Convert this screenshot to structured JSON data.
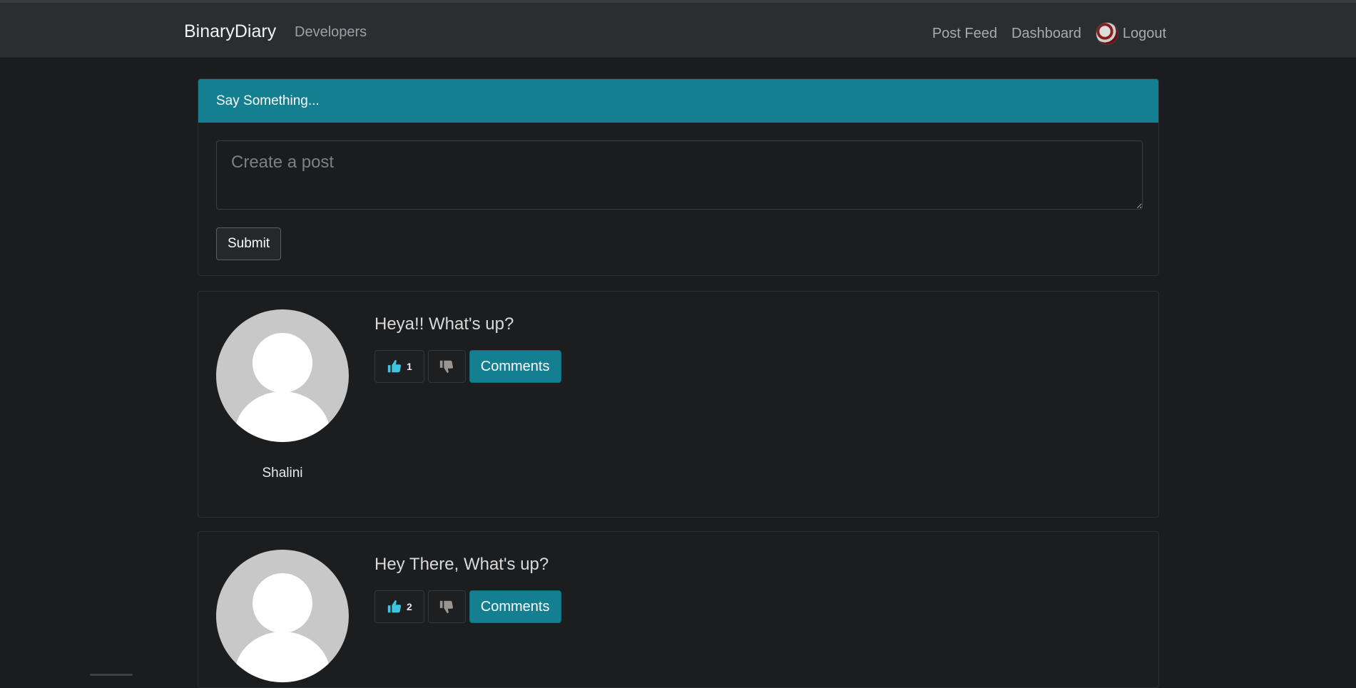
{
  "navbar": {
    "brand": "BinaryDiary",
    "developers": "Developers",
    "post_feed": "Post Feed",
    "dashboard": "Dashboard",
    "logout": "Logout"
  },
  "composer": {
    "header": "Say Something...",
    "placeholder": "Create a post",
    "submit": "Submit"
  },
  "posts": [
    {
      "text": "Heya!! What's up?",
      "author": "Shalini",
      "likes": "1",
      "comments_label": "Comments"
    },
    {
      "text": "Hey There, What's up?",
      "author": "",
      "likes": "2",
      "comments_label": "Comments"
    }
  ],
  "colors": {
    "accent": "#137f91",
    "like_icon": "#3ec6e0",
    "dislike_icon": "#9b9590"
  }
}
